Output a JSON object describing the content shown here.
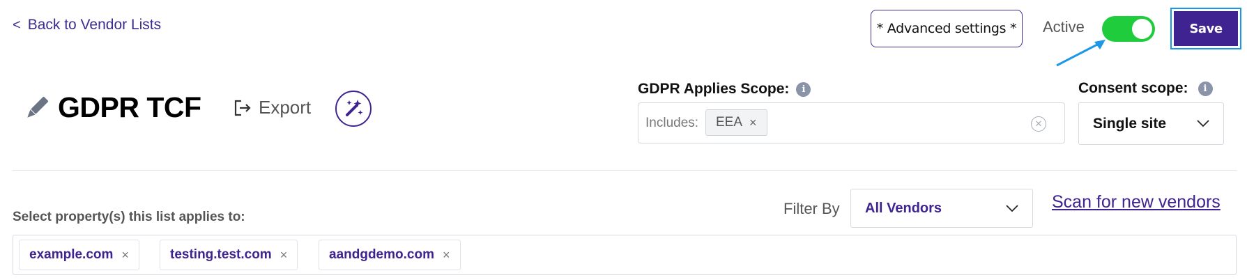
{
  "header": {
    "back_chevron": "<",
    "back_label": "Back to Vendor Lists",
    "advanced_settings_label": "* Advanced settings *",
    "active_label": "Active",
    "active_toggle_on": true,
    "save_label": "Save"
  },
  "list": {
    "title": "GDPR TCF",
    "export_label": "Export"
  },
  "gdpr_scope": {
    "label": "GDPR Applies Scope:",
    "info": "i",
    "includes_label": "Includes:",
    "tags": [
      "EEA"
    ],
    "remove_glyph": "×"
  },
  "consent_scope": {
    "label": "Consent scope:",
    "info": "i",
    "selected": "Single site"
  },
  "properties": {
    "label": "Select property(s) this list applies to:",
    "tags": [
      "example.com",
      "testing.test.com",
      "aandgdemo.com"
    ]
  },
  "filter": {
    "label": "Filter By",
    "selected": "All Vendors"
  },
  "scan_link": "Scan for new vendors",
  "colors": {
    "brand": "#3f2390",
    "toggle_on": "#1fcc3b",
    "focus_ring": "#1b97e8",
    "annotation_arrow": "#1b97e8"
  },
  "icons": {
    "pencil": "pencil-icon",
    "export": "export-icon",
    "magic": "magic-wand-icon",
    "chevron": "chevron-down-icon"
  }
}
